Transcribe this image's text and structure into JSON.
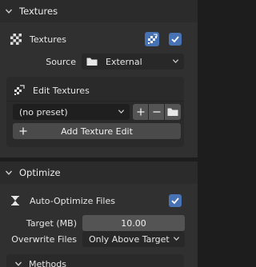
{
  "textures_section": {
    "header_title": "Textures",
    "enable_label": "Textures",
    "enabled": true,
    "source_label": "Source",
    "source_value": "External",
    "edit_panel": {
      "title": "Edit Textures",
      "preset_value": "(no preset)",
      "add_button_label": "Add Texture Edit"
    }
  },
  "optimize_section": {
    "header_title": "Optimize",
    "auto_optimize_label": "Auto-Optimize Files",
    "auto_optimize_enabled": true,
    "target_label": "Target (MB)",
    "target_value": "10.00",
    "overwrite_label": "Overwrite Files",
    "overwrite_value": "Only Above Target",
    "methods_label": "Methods"
  },
  "colors": {
    "accent": "#4772b3",
    "panel_bg": "#303030",
    "header_bg": "#2b2b2b",
    "field_bg": "#545454"
  }
}
